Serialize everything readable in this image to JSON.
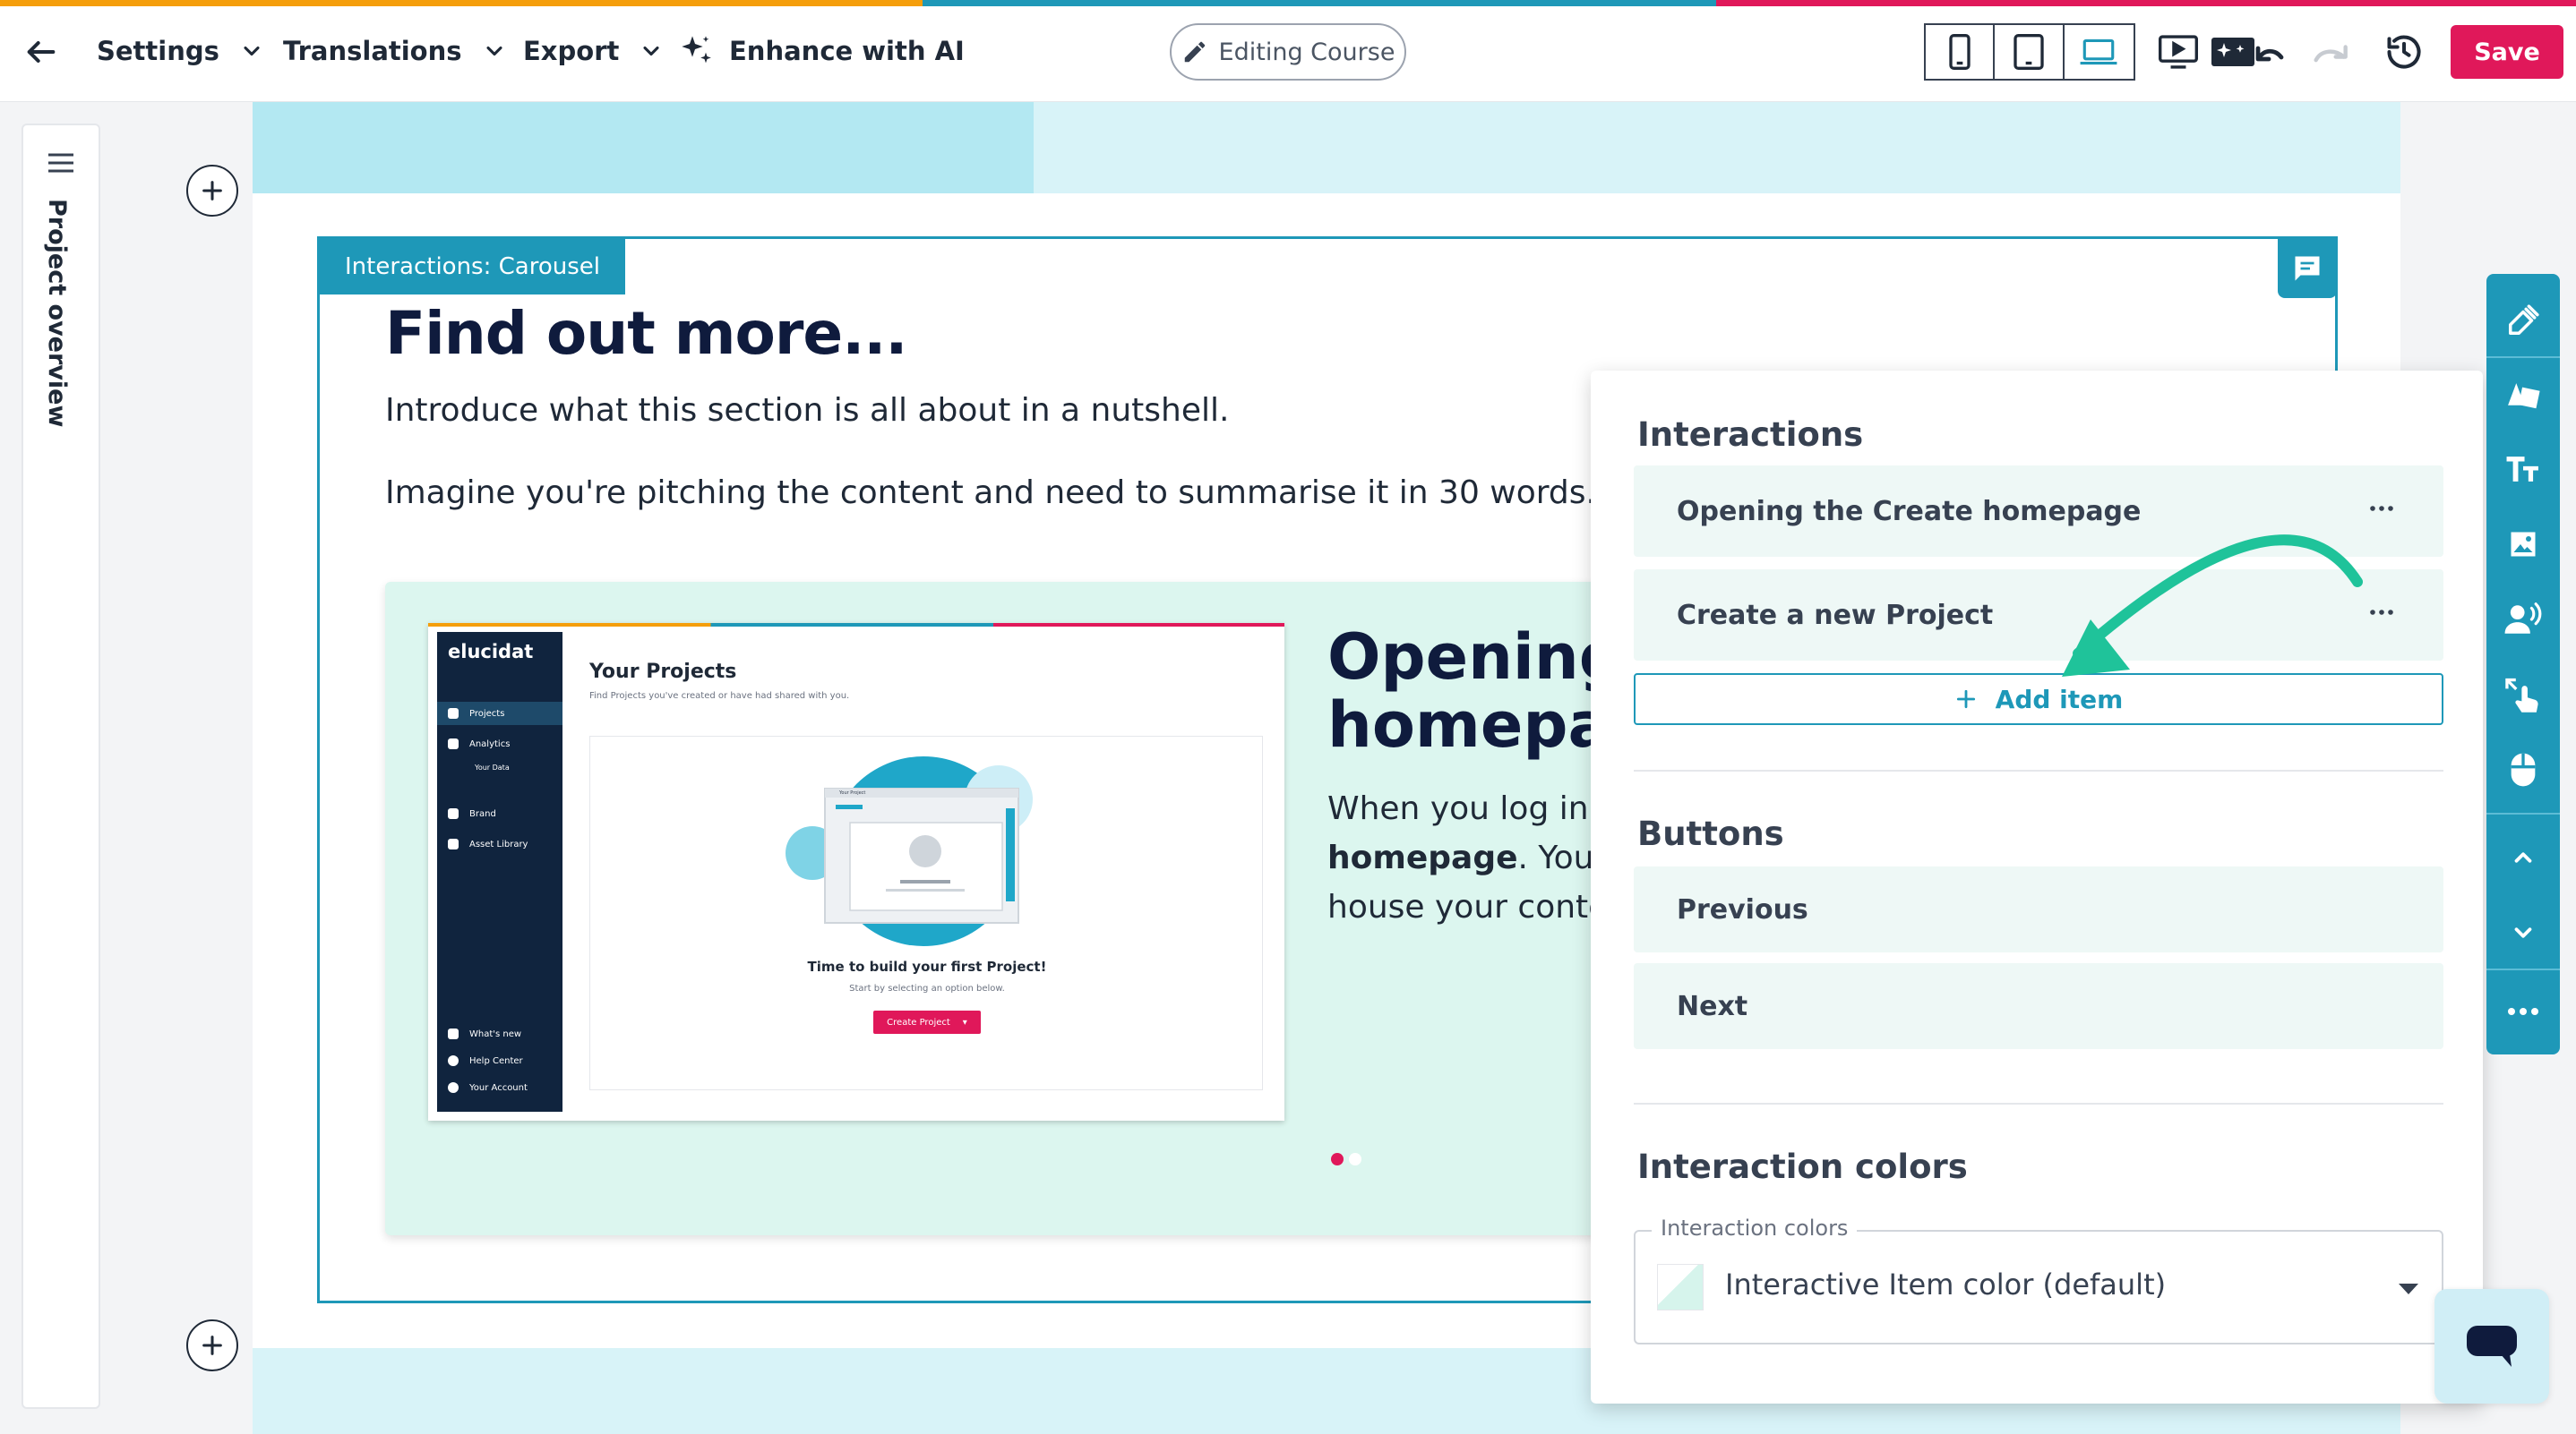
{
  "topbar": {
    "settings_label": "Settings",
    "translations_label": "Translations",
    "export_label": "Export",
    "enhance_label": "Enhance with AI",
    "editing_label": "Editing Course",
    "save_label": "Save"
  },
  "leftrail": {
    "label": "Project overview"
  },
  "section": {
    "tag": "Interactions: Carousel",
    "heading": "Find out more...",
    "intro1": "Introduce what this section is all about in a nutshell.",
    "intro2": "Imagine you're pitching the content and need to summarise it in 30 words."
  },
  "slide": {
    "title_line1": "Opening",
    "title_line2": "homepa",
    "body_line1": "When you log in t",
    "body_line2_bold": "homepage",
    "body_line2_rest": ". You c",
    "body_line3": "house your conte",
    "active_index": 0,
    "total": 2
  },
  "screenshot": {
    "logo": "elucidat",
    "nav": [
      "Projects",
      "Analytics",
      "Your Data",
      "Brand",
      "Asset Library",
      "What's new",
      "Help Center",
      "Your Account"
    ],
    "title": "Your Projects",
    "subtitle": "Find Projects you've created or have had shared with you.",
    "mini_title": "Your Project",
    "card_title": "Time to build your first Project!",
    "card_subtitle": "Start by selecting an option below.",
    "create_button": "Create Project"
  },
  "panel": {
    "interactions_heading": "Interactions",
    "interactions": [
      {
        "label": "Opening the Create homepage"
      },
      {
        "label": "Create a new Project"
      }
    ],
    "add_item_label": "Add item",
    "buttons_heading": "Buttons",
    "buttons": [
      {
        "label": "Previous"
      },
      {
        "label": "Next"
      }
    ],
    "colors_heading": "Interaction colors",
    "colors_field_label": "Interaction colors",
    "colors_value": "Interactive Item color (default)"
  },
  "colors": {
    "accent": "#1e98b8",
    "brand": "#e0185a",
    "arrow": "#1fc39a",
    "slide_bg": "#dcf6ef"
  },
  "icons": {
    "back": "arrow-left-icon",
    "sparkle": "sparkle-icon",
    "pencil": "pencil-icon",
    "phone": "phone-icon",
    "tablet": "tablet-icon",
    "laptop": "laptop-icon",
    "preview": "play-screen-icon",
    "ai_undo": "ai-undo-icon",
    "redo": "redo-icon",
    "history": "history-icon"
  }
}
